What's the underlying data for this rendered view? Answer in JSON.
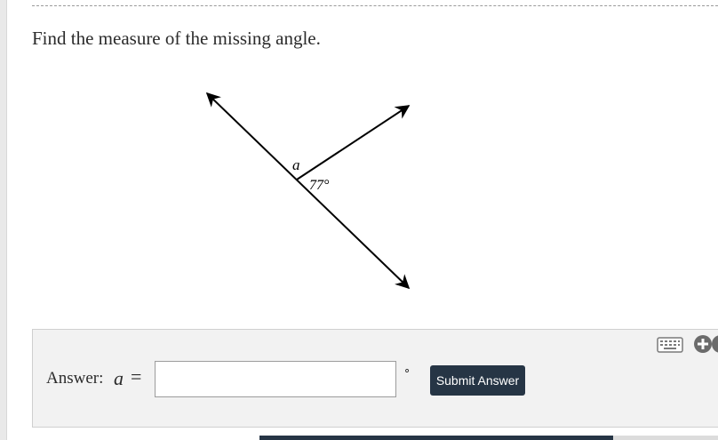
{
  "question": {
    "text": "Find the measure of the missing angle."
  },
  "diagram": {
    "unknown_label": "a",
    "given_angle_label": "77°"
  },
  "answer": {
    "label": "Answer:",
    "variable": "a",
    "equals": "=",
    "input_value": "",
    "unit_symbol": "∘",
    "submit_label": "Submit Answer"
  },
  "toolbar": {
    "icons": [
      "keyboard-icon",
      "plus-circle-icon",
      "partial-circle-icon"
    ]
  },
  "colors": {
    "button_bg": "#263545",
    "panel_bg": "#f2f2f2",
    "text": "#2b2b2b"
  }
}
